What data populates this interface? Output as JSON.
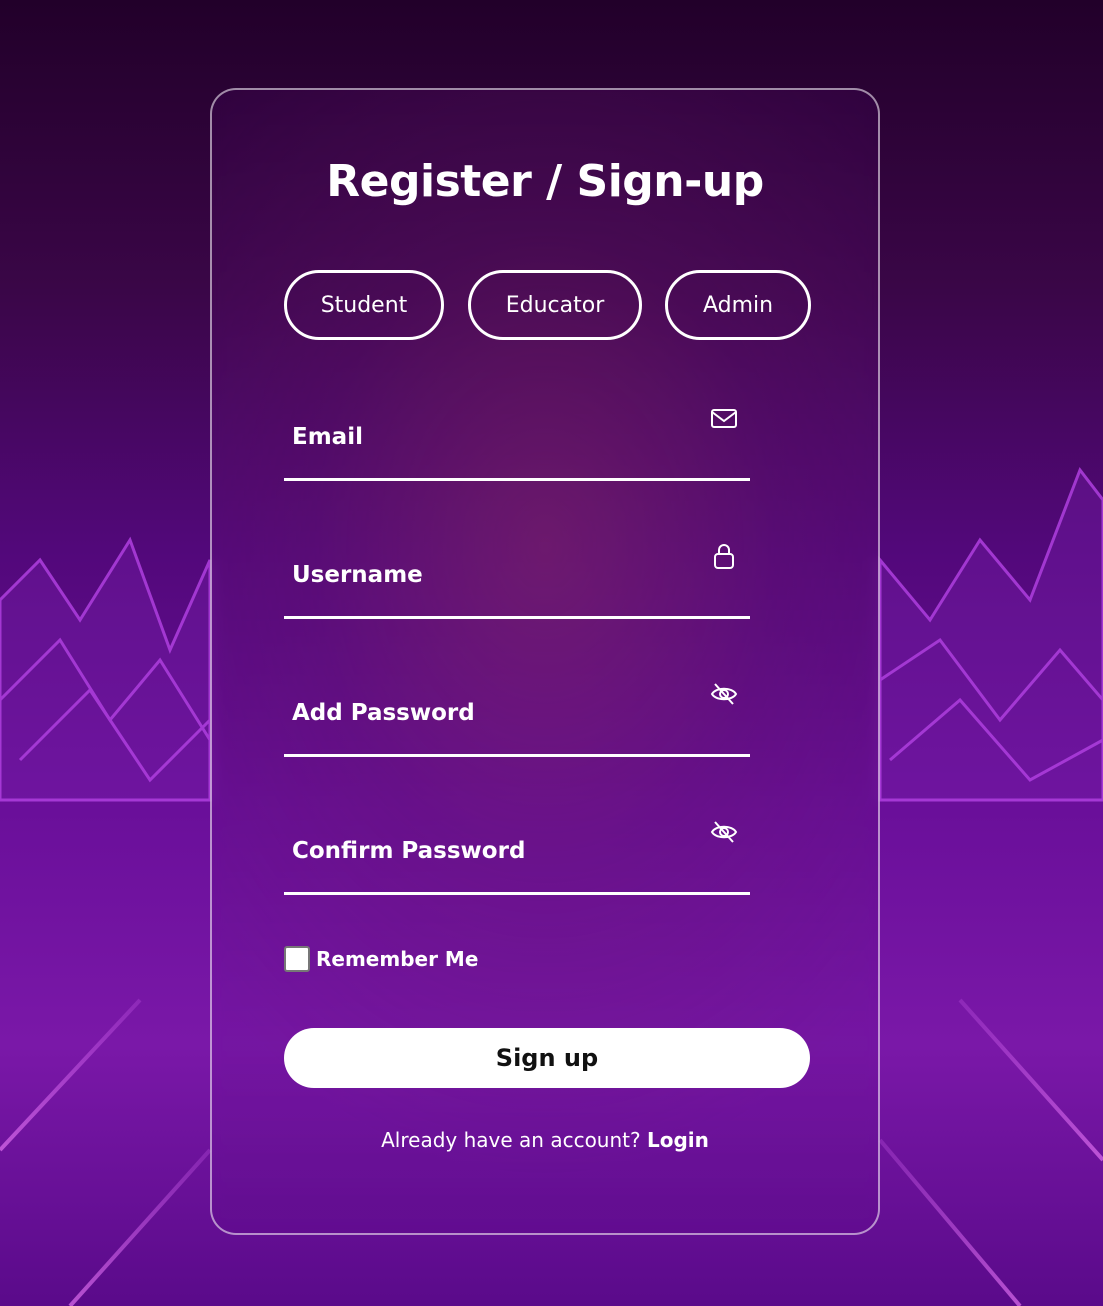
{
  "form": {
    "title": "Register / Sign-up",
    "roles": [
      "Student",
      "Educator",
      "Admin"
    ],
    "fields": [
      {
        "label": "Email",
        "icon": "envelope-icon"
      },
      {
        "label": "Username",
        "icon": "lock-icon"
      },
      {
        "label": "Add Password",
        "icon": "eye-slash-icon"
      },
      {
        "label": "Confirm Password",
        "icon": "eye-slash-icon"
      }
    ],
    "remember_label": "Remember Me",
    "remember_checked": false,
    "submit_label": "Sign up",
    "login_prompt": "Already have an account?",
    "login_link": "Login"
  },
  "colors": {
    "accent": "#ffffff",
    "background_top": "#22002a",
    "background_bottom": "#6a0f9a",
    "grid_neon": "#c040e0"
  }
}
